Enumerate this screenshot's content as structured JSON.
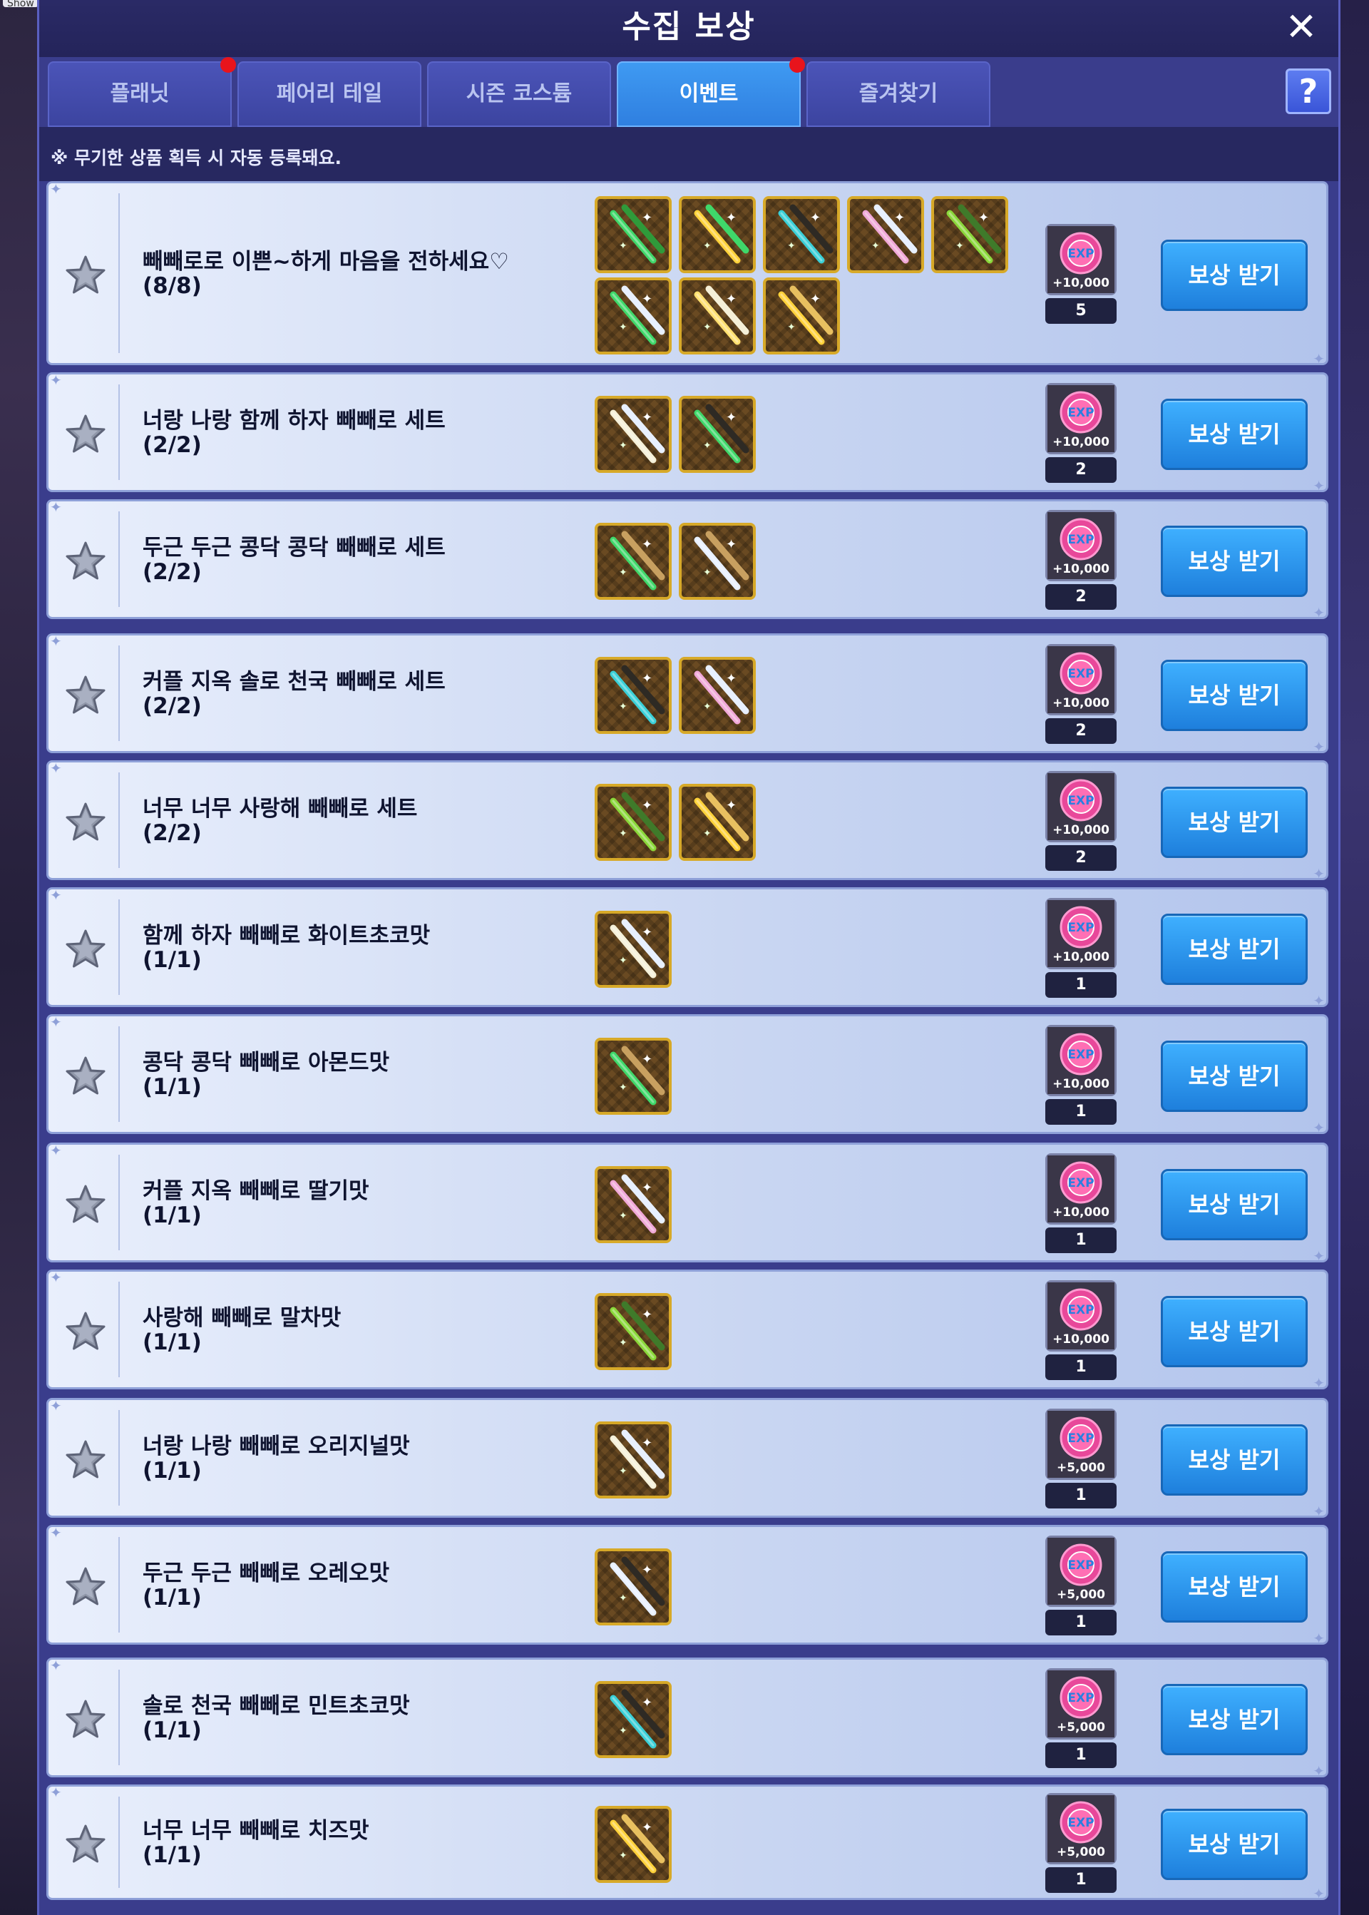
{
  "window": {
    "corner_tag": "Show",
    "title": "수집 보상",
    "close_label": "✕",
    "help_label": "?"
  },
  "tabs": [
    {
      "label": "플래닛",
      "active": false,
      "alert": true
    },
    {
      "label": "페어리 테일",
      "active": false,
      "alert": false
    },
    {
      "label": "시즌 코스튬",
      "active": false,
      "alert": false
    },
    {
      "label": "이벤트",
      "active": true,
      "alert": true
    },
    {
      "label": "즐겨찾기",
      "active": false,
      "alert": false
    }
  ],
  "notice": "※ 무기한 상품 획득 시 자동 등록돼요.",
  "claim_label": "보상 받기",
  "colors": {
    "panel": "#3a3d8c",
    "tab_active": "#2f7fe0",
    "button": "#1e7fdc",
    "item_border": "#d7a928",
    "alert_dot": "#e8141c"
  },
  "rows": [
    {
      "name": "빼빼로로 이쁜~하게 마음을 전하세요♡",
      "progress": "(8/8)",
      "reward_text": "+10,000",
      "reward_count": "5",
      "items": [
        [
          "#3fd86a",
          "#2f9a3a"
        ],
        [
          "#ffd23a",
          "#3fd86a"
        ],
        [
          "#3ad0d8",
          "#2e2a24"
        ],
        [
          "#f0a8d8",
          "#e8f0ff"
        ],
        [
          "#8ad83a",
          "#3f7a2a"
        ],
        [
          "#3fd86a",
          "#e8f0ff"
        ],
        [
          "#ffe070",
          "#f5f0d8"
        ],
        [
          "#ffd23a",
          "#e8c060"
        ]
      ]
    },
    {
      "name": "너랑 나랑 함께 하자 빼빼로 세트",
      "progress": "(2/2)",
      "reward_text": "+10,000",
      "reward_count": "2",
      "items": [
        [
          "#f5f0d8",
          "#e8f0ff"
        ],
        [
          "#3fd86a",
          "#2e2a24"
        ]
      ]
    },
    {
      "name": "두근 두근 콩닥 콩닥 빼빼로 세트",
      "progress": "(2/2)",
      "reward_text": "+10,000",
      "reward_count": "2",
      "items": [
        [
          "#3fd86a",
          "#c8a060"
        ],
        [
          "#e8f0ff",
          "#c8a060"
        ]
      ]
    },
    {
      "name": "커플 지옥 솔로 천국 빼빼로 세트",
      "progress": "(2/2)",
      "reward_text": "+10,000",
      "reward_count": "2",
      "items": [
        [
          "#3ad0d8",
          "#2e2a24"
        ],
        [
          "#f0a8d8",
          "#e8f0ff"
        ]
      ]
    },
    {
      "name": "너무 너무 사랑해 빼빼로 세트",
      "progress": "(2/2)",
      "reward_text": "+10,000",
      "reward_count": "2",
      "items": [
        [
          "#8ad83a",
          "#3f7a2a"
        ],
        [
          "#ffd23a",
          "#e8c060"
        ]
      ]
    },
    {
      "name": "함께 하자 빼빼로 화이트초코맛",
      "progress": "(1/1)",
      "reward_text": "+10,000",
      "reward_count": "1",
      "items": [
        [
          "#f5f0d8",
          "#e8f0ff"
        ]
      ]
    },
    {
      "name": "콩닥 콩닥 빼빼로 아몬드맛",
      "progress": "(1/1)",
      "reward_text": "+10,000",
      "reward_count": "1",
      "items": [
        [
          "#3fd86a",
          "#c8a060"
        ]
      ]
    },
    {
      "name": "커플 지옥 빼빼로 딸기맛",
      "progress": "(1/1)",
      "reward_text": "+10,000",
      "reward_count": "1",
      "items": [
        [
          "#f0a8d8",
          "#e8f0ff"
        ]
      ]
    },
    {
      "name": "사랑해 빼빼로 말차맛",
      "progress": "(1/1)",
      "reward_text": "+10,000",
      "reward_count": "1",
      "items": [
        [
          "#8ad83a",
          "#3f7a2a"
        ]
      ]
    },
    {
      "name": "너랑 나랑 빼빼로 오리지널맛",
      "progress": "(1/1)",
      "reward_text": "+5,000",
      "reward_count": "1",
      "items": [
        [
          "#f5f0d8",
          "#e8f0ff"
        ]
      ]
    },
    {
      "name": "두근 두근 빼빼로 오레오맛",
      "progress": "(1/1)",
      "reward_text": "+5,000",
      "reward_count": "1",
      "items": [
        [
          "#e8f0ff",
          "#2e2a24"
        ]
      ]
    },
    {
      "name": "솔로 천국 빼빼로 민트초코맛",
      "progress": "(1/1)",
      "reward_text": "+5,000",
      "reward_count": "1",
      "items": [
        [
          "#3ad0d8",
          "#2e2a24"
        ]
      ]
    },
    {
      "name": "너무 너무 빼빼로 치즈맛",
      "progress": "(1/1)",
      "reward_text": "+5,000",
      "reward_count": "1",
      "items": [
        [
          "#ffd23a",
          "#e8c060"
        ]
      ]
    }
  ]
}
